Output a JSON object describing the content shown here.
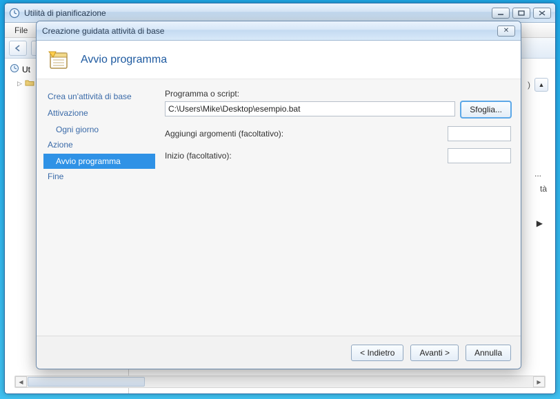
{
  "parent": {
    "title": "Utilità di pianificazione",
    "menubar": {
      "file": "File"
    },
    "tree": {
      "root_short": "Ut",
      "expand": "▷"
    },
    "right": {
      "chev": "▲",
      "paren": ")",
      "ellipsis": "...",
      "tail": "tà",
      "play": "▶"
    },
    "scroll": {
      "left": "◀",
      "right": "▶"
    }
  },
  "wizard": {
    "title": "Creazione guidata attività di base",
    "heading": "Avvio programma",
    "close": "✕",
    "nav": {
      "create": "Crea un'attività di base",
      "trigger": "Attivazione",
      "daily": "Ogni giorno",
      "action": "Azione",
      "start_program": "Avvio programma",
      "finish": "Fine"
    },
    "form": {
      "program_label": "Programma o script:",
      "program_value": "C:\\Users\\Mike\\Desktop\\esempio.bat",
      "browse": "Sfoglia...",
      "args_label": "Aggiungi argomenti (facoltativo):",
      "args_value": "",
      "startin_label": "Inizio (facoltativo):",
      "startin_value": ""
    },
    "buttons": {
      "back": "< Indietro",
      "next": "Avanti >",
      "cancel": "Annulla"
    }
  }
}
